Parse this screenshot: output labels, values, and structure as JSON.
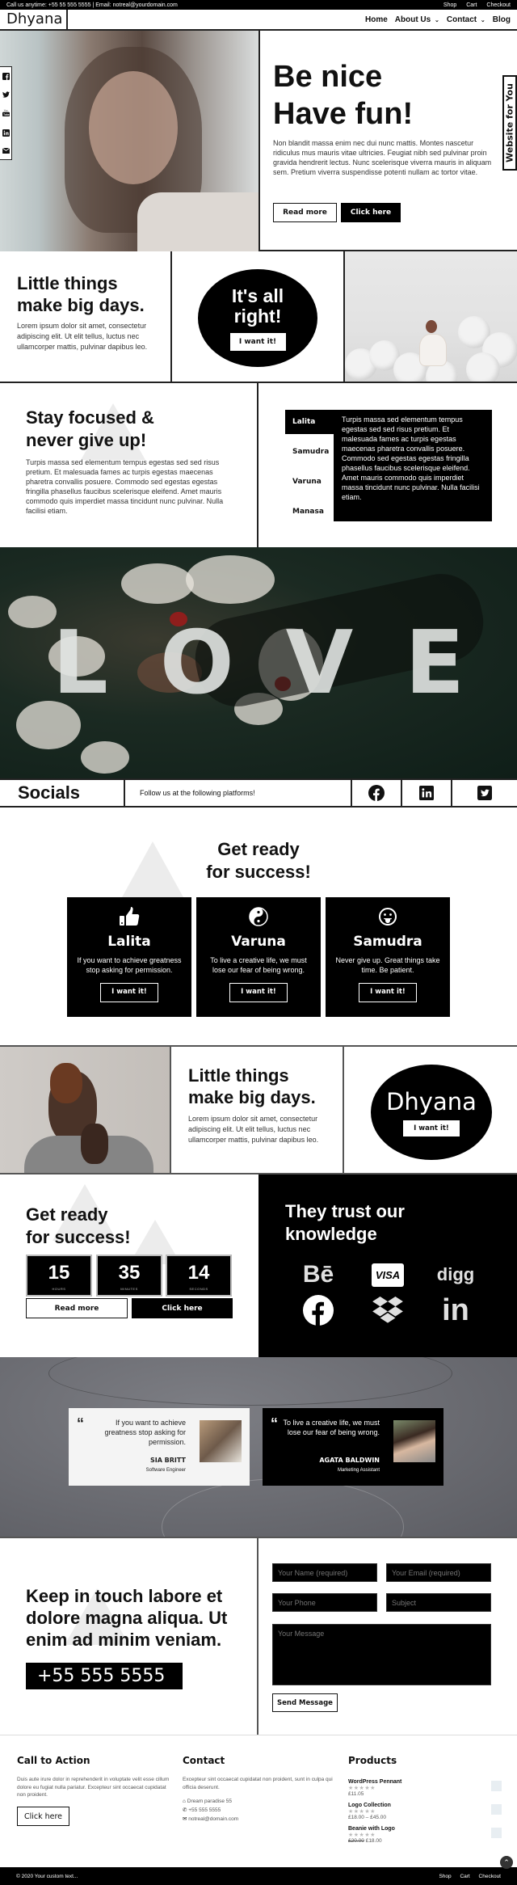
{
  "topbar": {
    "contact_text": "Call us anytime: +55 55 555 5555 | Email: notreal@yourdomain.com",
    "links": [
      "Shop",
      "Cart",
      "Checkout"
    ]
  },
  "header": {
    "logo": "Dhyana",
    "nav": [
      {
        "label": "Home",
        "has_dropdown": false
      },
      {
        "label": "About Us",
        "has_dropdown": true
      },
      {
        "label": "Contact",
        "has_dropdown": true
      },
      {
        "label": "Blog",
        "has_dropdown": false
      }
    ]
  },
  "social_rail": {
    "icons": [
      "facebook-icon",
      "twitter-icon",
      "youtube-icon",
      "linkedin-icon",
      "email-icon"
    ]
  },
  "hero": {
    "title_line1": "Be nice",
    "title_line2": "Have fun!",
    "body": "Non blandit massa enim nec dui nunc mattis. Montes nascetur ridiculus mus mauris vitae ultricies. Feugiat nibh sed pulvinar proin gravida hendrerit lectus. Nunc scelerisque viverra mauris in aliquam sem. Pretium viverra suspendisse potenti nullam ac tortor vitae.",
    "read_more": "Read more",
    "click_here": "Click here",
    "side_tab": "Website for You"
  },
  "row2": {
    "title_line1": "Little things",
    "title_line2": "make big days.",
    "body": "Lorem ipsum dolor sit amet, consectetur adipiscing elit. Ut elit tellus, luctus nec ullamcorper mattis, pulvinar dapibus leo.",
    "circle_line1": "It's all",
    "circle_line2": "right!",
    "circle_button": "I want it!"
  },
  "row3": {
    "title_line1": "Stay focused &",
    "title_line2": "never give up!",
    "body": "Turpis massa sed elementum tempus egestas sed sed risus pretium. Et malesuada fames ac turpis egestas maecenas pharetra convallis posuere. Commodo sed egestas egestas fringilla phasellus faucibus scelerisque eleifend. Amet mauris commodo quis imperdiet massa tincidunt nunc pulvinar. Nulla facilisi etiam.",
    "tabs": [
      "Lalita",
      "Samudra",
      "Varuna",
      "Manasa"
    ],
    "active_tab": "Lalita",
    "tab_content": "Turpis massa sed elementum tempus egestas sed sed risus pretium. Et malesuada fames ac turpis egestas maecenas pharetra convallis posuere. Commodo sed egestas egestas fringilla phasellus faucibus scelerisque eleifend. Amet mauris commodo quis imperdiet massa tincidunt nunc pulvinar. Nulla facilisi etiam."
  },
  "banner": {
    "letters": [
      "L",
      "O",
      "V",
      "E"
    ]
  },
  "socials": {
    "title": "Socials",
    "text": "Follow us at the following platforms!",
    "icons": [
      "facebook-icon",
      "linkedin-icon",
      "twitter-icon"
    ]
  },
  "ready": {
    "title_line1": "Get ready",
    "title_line2": "for success!",
    "cards": [
      {
        "icon": "thumbs-up-icon",
        "name": "Lalita",
        "desc": "If you want to achieve greatness stop asking for permission.",
        "button": "I want it!"
      },
      {
        "icon": "yin-yang-icon",
        "name": "Varuna",
        "desc": "To live a creative life, we must lose our fear of being wrong.",
        "button": "I want it!"
      },
      {
        "icon": "tongue-smiley-icon",
        "name": "Samudra",
        "desc": "Never give up. Great things take time. Be patient.",
        "button": "I want it!"
      }
    ]
  },
  "row5": {
    "title_line1": "Little things",
    "title_line2": "make big days.",
    "body": "Lorem ipsum dolor sit amet, consectetur adipiscing elit. Ut elit tellus, luctus nec ullamcorper mattis, pulvinar dapibus leo.",
    "circle_title": "Dhyana",
    "circle_button": "I want it!"
  },
  "countdown": {
    "title_line1": "Get ready",
    "title_line2": "for success!",
    "units": [
      {
        "value": "15",
        "label": "HOURS"
      },
      {
        "value": "35",
        "label": "MINUTES"
      },
      {
        "value": "14",
        "label": "SECONDS"
      }
    ],
    "read_more": "Read more",
    "click_here": "Click here"
  },
  "trust": {
    "title_line1": "They trust our",
    "title_line2": "knowledge",
    "logos": [
      "behance-icon",
      "visa-icon",
      "digg-icon",
      "facebook-icon",
      "dropbox-icon",
      "linkedin-icon"
    ],
    "behance": "Bē",
    "visa": "VISA",
    "digg": "digg",
    "linkedin": "in"
  },
  "testimonials": [
    {
      "quote": "If you want to achieve greatness stop asking for permission.",
      "name": "SIA BRITT",
      "role": "Software Engineer",
      "theme": "light"
    },
    {
      "quote": "To live a creative life, we must lose our fear of being wrong.",
      "name": "AGATA BALDWIN",
      "role": "Marketing Assistant",
      "theme": "dark"
    }
  ],
  "contact": {
    "title": "Keep in touch labore et dolore magna aliqua. Ut enim ad minim veniam.",
    "phone": "+55 555 5555",
    "fields": {
      "name_placeholder": "Your Name (required)",
      "email_placeholder": "Your Email (required)",
      "phone_placeholder": "Your Phone",
      "subject_placeholder": "Subject",
      "message_placeholder": "Your Message"
    },
    "send_button": "Send Message"
  },
  "footer": {
    "cta": {
      "title": "Call to Action",
      "text": "Duis aute irure dolor in reprehenderit in voluptate velit esse cillum dolore eu fugiat nulla pariatur. Excepteur sint occaecat cupidatat non proident.",
      "button": "Click here"
    },
    "contact": {
      "title": "Contact",
      "text": "Excepteur sint occaecat cupidatat non proident, sunt in culpa qui officia deserunt.",
      "address": "Dream paradise 55",
      "phone": "+55 555 5555",
      "email": "notreal@domain.com"
    },
    "products": {
      "title": "Products",
      "items": [
        {
          "name": "WordPress Pennant",
          "price": "£11.05",
          "old_price": "",
          "rating": "0/5"
        },
        {
          "name": "Logo Collection",
          "price": "£18.00 – £45.00",
          "old_price": "",
          "rating": "0/5"
        },
        {
          "name": "Beanie with Logo",
          "price": "£18.00",
          "old_price": "£20.00",
          "rating": "0/5"
        }
      ]
    },
    "copyright": "© 2020 Your custom text...",
    "links": [
      "Shop",
      "Cart",
      "Checkout"
    ]
  }
}
